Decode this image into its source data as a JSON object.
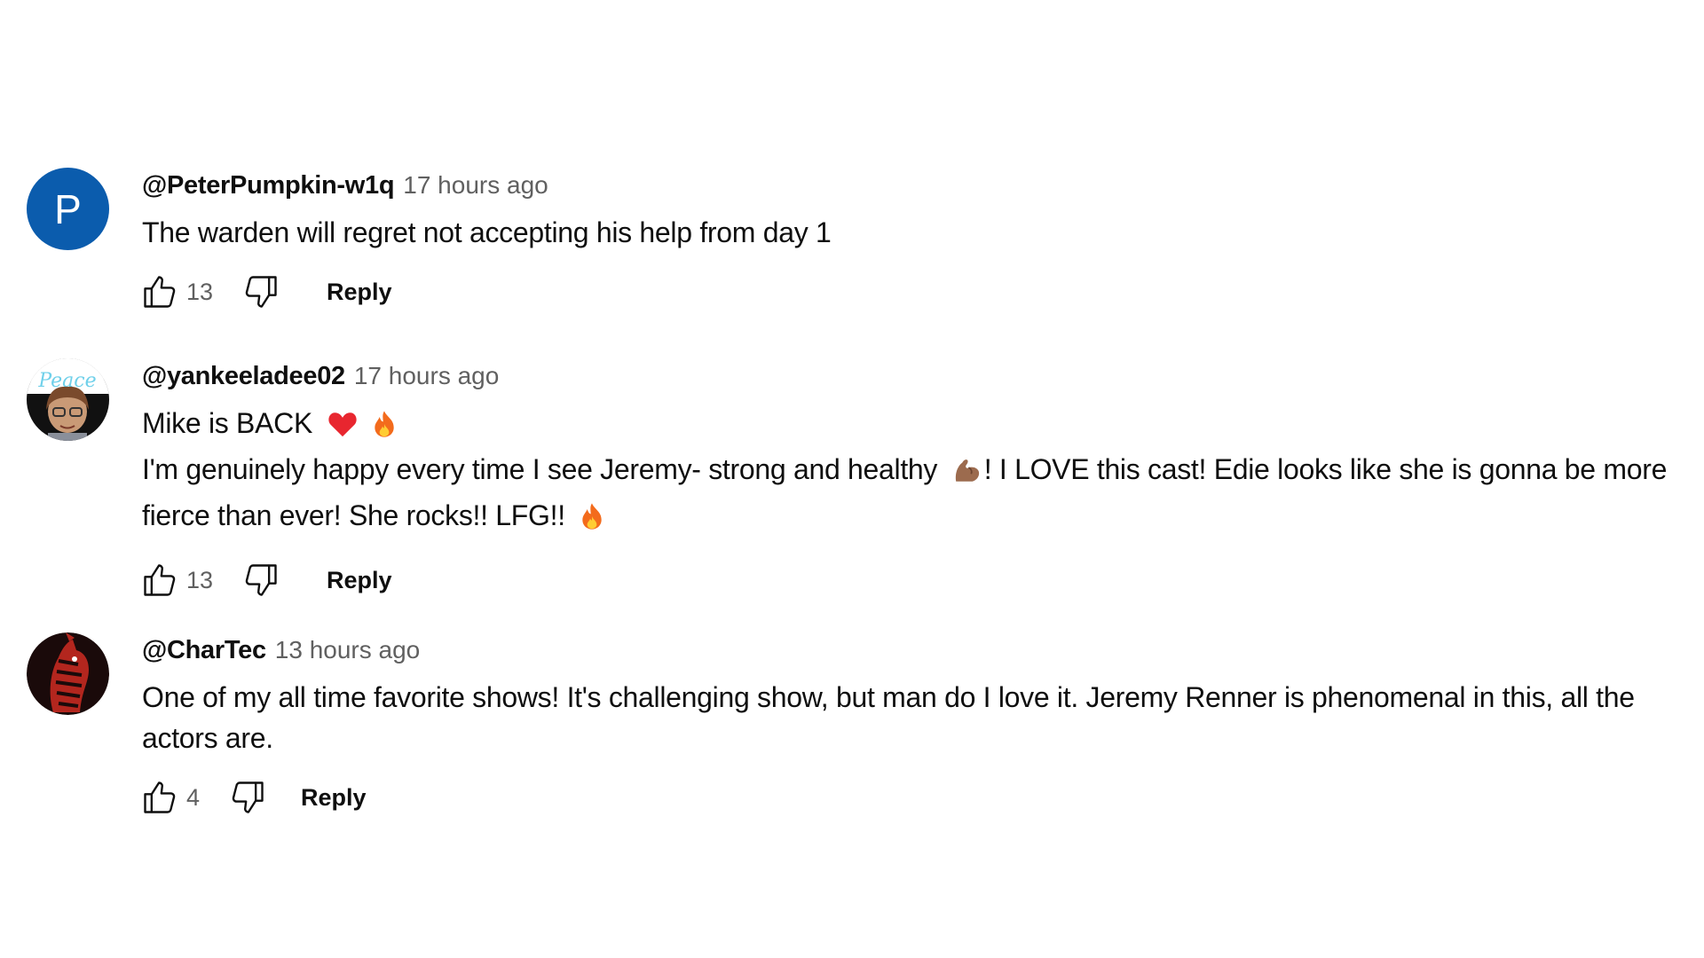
{
  "comments": [
    {
      "author": "@PeterPumpkin-w1q",
      "time": "17 hours ago",
      "avatar_letter": "P",
      "avatar_color": "#0b5cad",
      "lines": [
        "The warden will regret not accepting his help from day 1"
      ],
      "likes": "13",
      "reply_label": "Reply"
    },
    {
      "author": "@yankeeladee02",
      "time": "17 hours ago",
      "line1": "Mike is BACK",
      "line2a": "I'm genuinely happy every time I see Jeremy- strong and healthy",
      "line2b": "! I LOVE this cast! Edie looks like she is gonna be more",
      "line3": "fierce than ever! She rocks!! LFG!!",
      "avatar_lettering": "Peace",
      "likes": "13",
      "reply_label": "Reply"
    },
    {
      "author": "@CharTec",
      "time": "13 hours ago",
      "lines": [
        "One of my all time favorite shows! It's challenging show, but man do I love it. Jeremy Renner is phenomenal in this, all the",
        "actors are."
      ],
      "likes": "4",
      "reply_label": "Reply"
    }
  ],
  "icons": {
    "like": "thumbs-up-icon",
    "dislike": "thumbs-down-icon",
    "heart": "red-heart-emoji",
    "fire": "fire-emoji",
    "muscle": "flexed-biceps-emoji"
  },
  "colors": {
    "text": "#0f0f0f",
    "muted": "#606060",
    "avatar_blue": "#0b5cad"
  }
}
